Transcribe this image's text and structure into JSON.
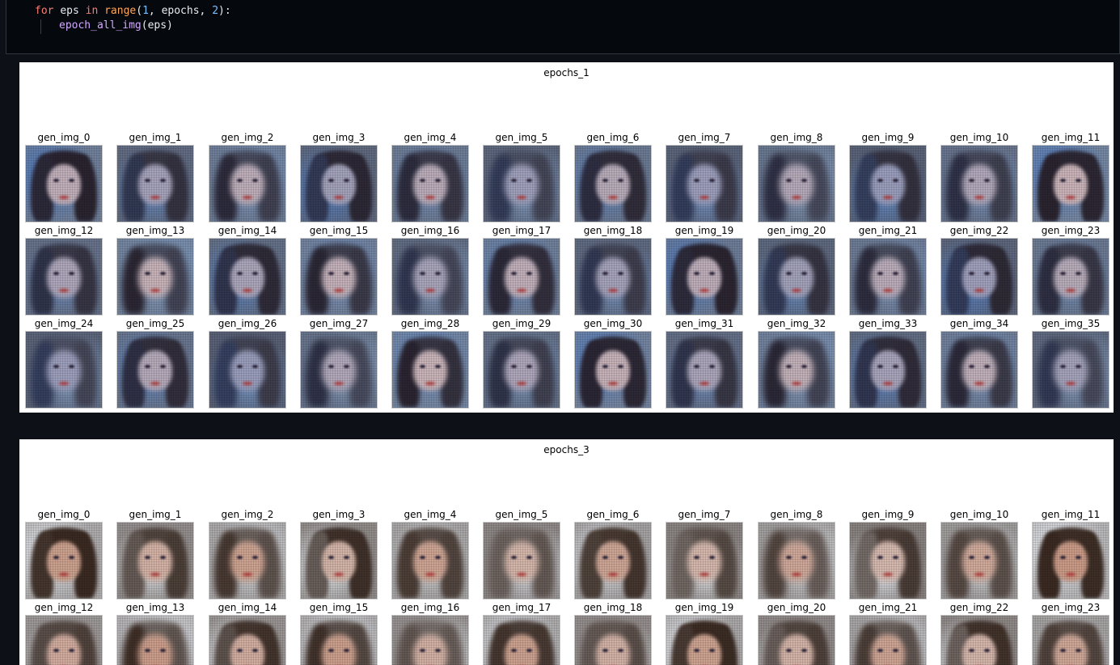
{
  "code": {
    "line1": {
      "kw_for": "for",
      "var_eps": "eps",
      "kw_in": "in",
      "fn_range": "range",
      "open": "(",
      "arg1": "1",
      "sep1": ", ",
      "arg2": "epochs",
      "sep2": ", ",
      "arg3": "2",
      "close": "):"
    },
    "line2": {
      "fn_call": "epoch_all_img",
      "args": "(eps)"
    }
  },
  "figures": [
    {
      "title": "epochs_1",
      "labels": [
        "gen_img_0",
        "gen_img_1",
        "gen_img_2",
        "gen_img_3",
        "gen_img_4",
        "gen_img_5",
        "gen_img_6",
        "gen_img_7",
        "gen_img_8",
        "gen_img_9",
        "gen_img_10",
        "gen_img_11",
        "gen_img_12",
        "gen_img_13",
        "gen_img_14",
        "gen_img_15",
        "gen_img_16",
        "gen_img_17",
        "gen_img_18",
        "gen_img_19",
        "gen_img_20",
        "gen_img_21",
        "gen_img_22",
        "gen_img_23",
        "gen_img_24",
        "gen_img_25",
        "gen_img_26",
        "gen_img_27",
        "gen_img_28",
        "gen_img_29",
        "gen_img_30",
        "gen_img_31",
        "gen_img_32",
        "gen_img_33",
        "gen_img_34",
        "gen_img_35"
      ],
      "palette": {
        "bg": "#8fa8c8",
        "skin": "#c9b3b8",
        "hair": "#2a2430",
        "accent": "#4a78c0"
      }
    },
    {
      "title": "epochs_3",
      "labels": [
        "gen_img_0",
        "gen_img_1",
        "gen_img_2",
        "gen_img_3",
        "gen_img_4",
        "gen_img_5",
        "gen_img_6",
        "gen_img_7",
        "gen_img_8",
        "gen_img_9",
        "gen_img_10",
        "gen_img_11",
        "gen_img_12",
        "gen_img_13",
        "gen_img_14",
        "gen_img_15",
        "gen_img_16",
        "gen_img_17",
        "gen_img_18",
        "gen_img_19",
        "gen_img_20",
        "gen_img_21",
        "gen_img_22",
        "gen_img_23"
      ],
      "palette": {
        "bg": "#dfe3e8",
        "skin": "#c99a86",
        "hair": "#3a2a22",
        "accent": "#e8ecf2"
      }
    }
  ]
}
